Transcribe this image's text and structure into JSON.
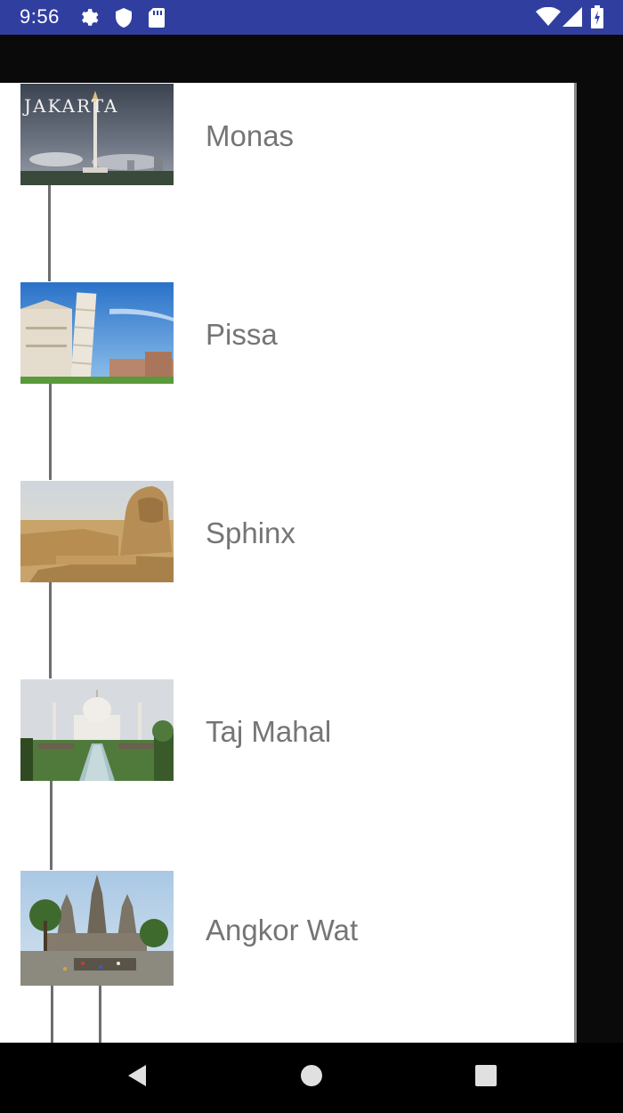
{
  "status_bar": {
    "time": "9:56",
    "icons": [
      "gear-icon",
      "shield-icon",
      "sd-card-icon",
      "wifi-icon",
      "signal-icon",
      "battery-icon"
    ]
  },
  "places": [
    {
      "name": "Monas",
      "image": "monas-image",
      "image_text": "JAKARTA"
    },
    {
      "name": "Pissa",
      "image": "pisa-tower-image"
    },
    {
      "name": "Sphinx",
      "image": "sphinx-image"
    },
    {
      "name": "Taj Mahal",
      "image": "taj-mahal-image"
    },
    {
      "name": "Angkor Wat",
      "image": "angkor-wat-image"
    }
  ],
  "nav_bar": {
    "buttons": [
      "back-icon",
      "home-icon",
      "recents-icon"
    ]
  }
}
